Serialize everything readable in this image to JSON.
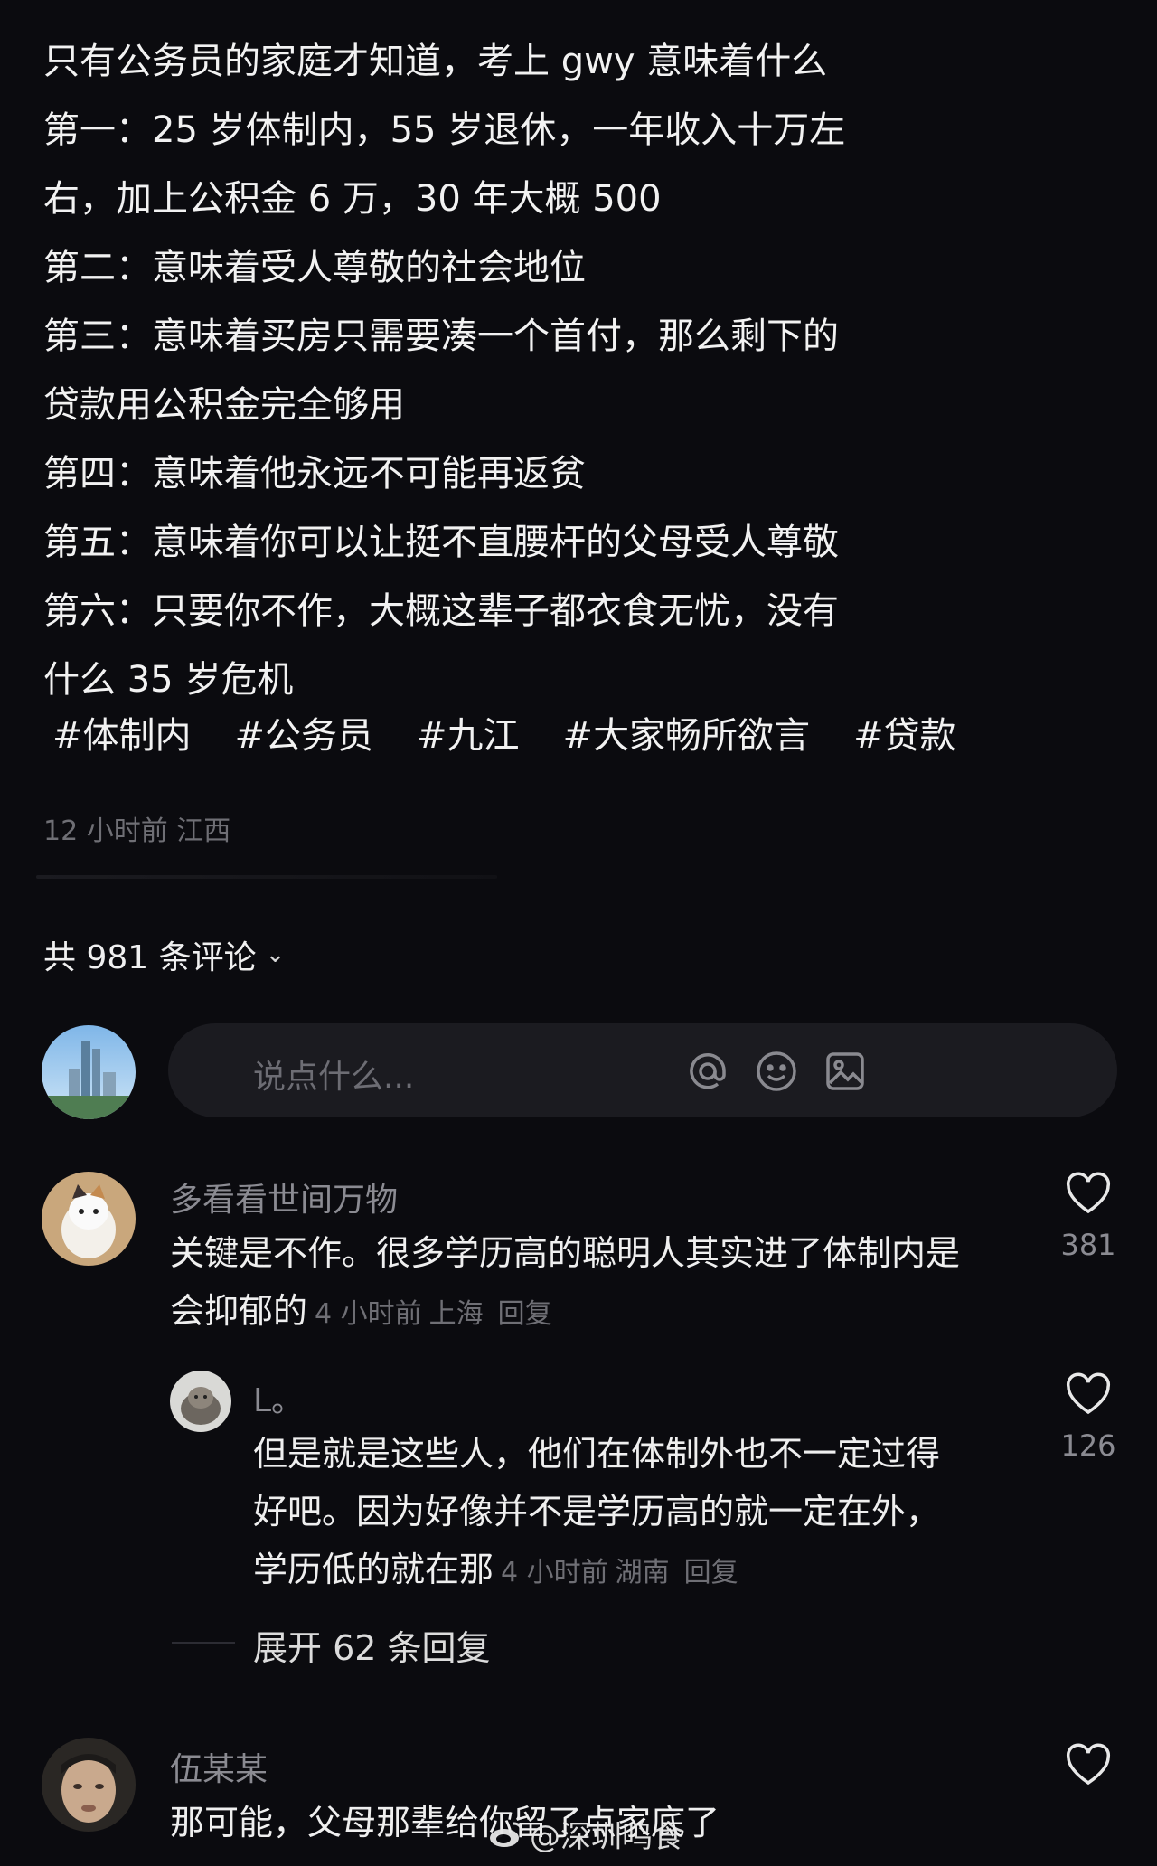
{
  "post": {
    "lines": [
      "只有公务员的家庭才知道，考上 gwy 意味着什么",
      "第一：25 岁体制内，55 岁退休，一年收入十万左",
      "右，加上公积金 6 万，30 年大概 500",
      "第二：意味着受人尊敬的社会地位",
      "第三：意味着买房只需要凑一个首付，那么剩下的",
      "贷款用公积金完全够用",
      "第四：意味着他永远不可能再返贫",
      "第五：意味着你可以让挺不直腰杆的父母受人尊敬",
      "第六：只要你不作，大概这辈子都衣食无忧，没有",
      "什么 35 岁危机"
    ],
    "tags": [
      "#体制内",
      "#公务员",
      "#九江",
      "#大家畅所欲言",
      "#贷款"
    ],
    "meta": "12 小时前  江西"
  },
  "comments_header": {
    "count_label": "共 981 条评论",
    "chevron": "⌄"
  },
  "composer": {
    "placeholder": "说点什么...",
    "icons": [
      "at-icon",
      "emoji-icon",
      "image-icon"
    ]
  },
  "comments": [
    {
      "user": "多看看世间万物",
      "text_line1": "关键是不作。很多学历高的聪明人其实进了体制内是",
      "text_line2": "会抑郁的",
      "time": "4 小时前",
      "location": "上海",
      "reply_label": "回复",
      "likes": "381"
    },
    {
      "user": "L。",
      "text_line1": "但是就是这些人，他们在体制外也不一定过得",
      "text_line2": "好吧。因为好像并不是学历高的就一定在外，",
      "text_line3": "学历低的就在那",
      "time": "4 小时前",
      "location": "湖南",
      "reply_label": "回复",
      "likes": "126"
    },
    {
      "user": "伍某某",
      "text_line1": "那可能，父母那辈给你留了点家底了"
    }
  ],
  "expand_replies": "展开 62 条回复",
  "watermark": "@深圳鸣食",
  "colors": {
    "background": "#0b0b0f",
    "text": "#ececec",
    "muted": "#6f6f75",
    "input_bg": "#1b1b20"
  }
}
